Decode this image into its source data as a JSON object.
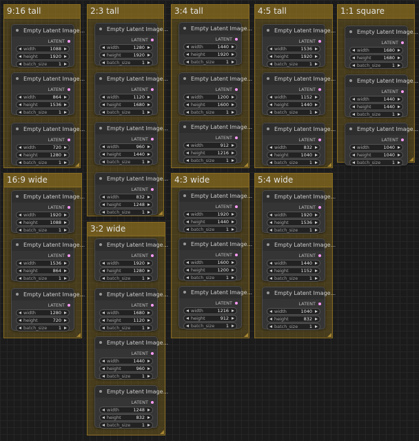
{
  "node_title": "Empty Latent Image...",
  "output_label": "LATENT",
  "widget_labels": {
    "width": "width",
    "height": "height",
    "batch_size": "batch_size"
  },
  "colors": {
    "group_fill": "#96761e",
    "latent_socket": "#ff9cf9",
    "canvas": "#1b1b1b"
  },
  "groups": [
    {
      "title": "9:16 tall",
      "nodes": [
        {
          "width": "1088",
          "height": "1920",
          "batch_size": "1"
        },
        {
          "width": "864",
          "height": "1536",
          "batch_size": "1"
        },
        {
          "width": "720",
          "height": "1280",
          "batch_size": "1"
        }
      ]
    },
    {
      "title": "2:3 tall",
      "nodes": [
        {
          "width": "1280",
          "height": "1920",
          "batch_size": "1"
        },
        {
          "width": "1120",
          "height": "1680",
          "batch_size": "1"
        },
        {
          "width": "960",
          "height": "1440",
          "batch_size": "1"
        },
        {
          "width": "832",
          "height": "1248",
          "batch_size": "1"
        }
      ]
    },
    {
      "title": "3:4 tall",
      "nodes": [
        {
          "width": "1440",
          "height": "1920",
          "batch_size": "1"
        },
        {
          "width": "1200",
          "height": "1600",
          "batch_size": "1"
        },
        {
          "width": "912",
          "height": "1216",
          "batch_size": "1"
        }
      ]
    },
    {
      "title": "4:5 tall",
      "nodes": [
        {
          "width": "1536",
          "height": "1920",
          "batch_size": "1"
        },
        {
          "width": "1152",
          "height": "1440",
          "batch_size": "1"
        },
        {
          "width": "832",
          "height": "1040",
          "batch_size": "1"
        }
      ]
    },
    {
      "title": "1:1 square",
      "nodes": [
        {
          "width": "1680",
          "height": "1680",
          "batch_size": "1"
        },
        {
          "width": "1440",
          "height": "1440",
          "batch_size": "1"
        },
        {
          "width": "1040",
          "height": "1040",
          "batch_size": "1"
        }
      ]
    },
    {
      "title": "16:9 wide",
      "nodes": [
        {
          "width": "1920",
          "height": "1088",
          "batch_size": "1"
        },
        {
          "width": "1536",
          "height": "864",
          "batch_size": "1"
        },
        {
          "width": "1280",
          "height": "720",
          "batch_size": "1"
        }
      ]
    },
    {
      "title": "3:2 wide",
      "nodes": [
        {
          "width": "1920",
          "height": "1280",
          "batch_size": "1"
        },
        {
          "width": "1680",
          "height": "1120",
          "batch_size": "1"
        },
        {
          "width": "1440",
          "height": "960",
          "batch_size": "1"
        },
        {
          "width": "1248",
          "height": "832",
          "batch_size": "1"
        }
      ]
    },
    {
      "title": "4:3 wide",
      "nodes": [
        {
          "width": "1920",
          "height": "1440",
          "batch_size": "1"
        },
        {
          "width": "1600",
          "height": "1200",
          "batch_size": "1"
        },
        {
          "width": "1216",
          "height": "912",
          "batch_size": "1"
        }
      ]
    },
    {
      "title": "5:4  wide",
      "nodes": [
        {
          "width": "1920",
          "height": "1536",
          "batch_size": "1"
        },
        {
          "width": "1440",
          "height": "1152",
          "batch_size": "1"
        },
        {
          "width": "1040",
          "height": "832",
          "batch_size": "1"
        }
      ]
    }
  ]
}
